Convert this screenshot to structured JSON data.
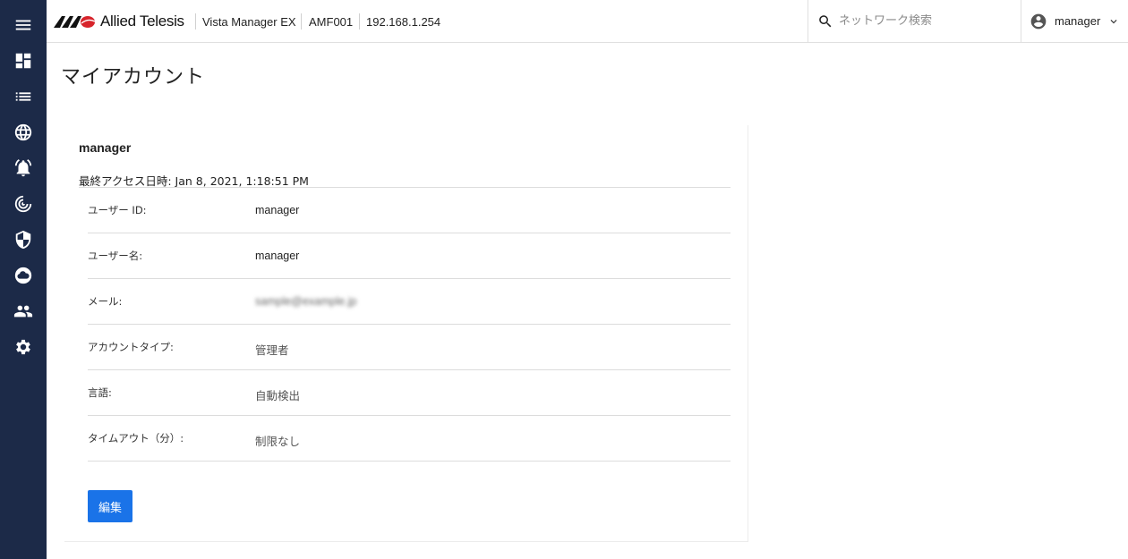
{
  "header": {
    "brand": "Allied Telesis",
    "product": "Vista Manager EX",
    "device": "AMF001",
    "ip": "192.168.1.254",
    "search_placeholder": "ネットワーク検索",
    "user": "manager"
  },
  "sidebar": {
    "items": [
      {
        "icon": "menu-icon"
      },
      {
        "icon": "dashboard-icon"
      },
      {
        "icon": "list-icon"
      },
      {
        "icon": "globe-icon"
      },
      {
        "icon": "alarm-icon"
      },
      {
        "icon": "radar-icon"
      },
      {
        "icon": "shield-icon"
      },
      {
        "icon": "cloud-icon"
      },
      {
        "icon": "people-icon"
      },
      {
        "icon": "settings-icon"
      }
    ]
  },
  "page": {
    "title": "マイアカウント"
  },
  "account": {
    "username": "manager",
    "last_access": "最終アクセス日時: Jan 8, 2021, 1:18:51 PM",
    "rows": [
      {
        "label": "ユーザー ID:",
        "value": "manager"
      },
      {
        "label": "ユーザー名:",
        "value": "manager"
      },
      {
        "label": "メール:",
        "value": "sample@example.jp"
      },
      {
        "label": "アカウントタイプ:",
        "value": "管理者"
      },
      {
        "label": "言語:",
        "value": "自動検出"
      },
      {
        "label": "タイムアウト（分）:",
        "value": "制限なし"
      }
    ],
    "edit_label": "編集"
  },
  "colors": {
    "sidebar_bg": "#1c2a48",
    "primary_button": "#1a73e8",
    "logo_red": "#d7242b"
  }
}
